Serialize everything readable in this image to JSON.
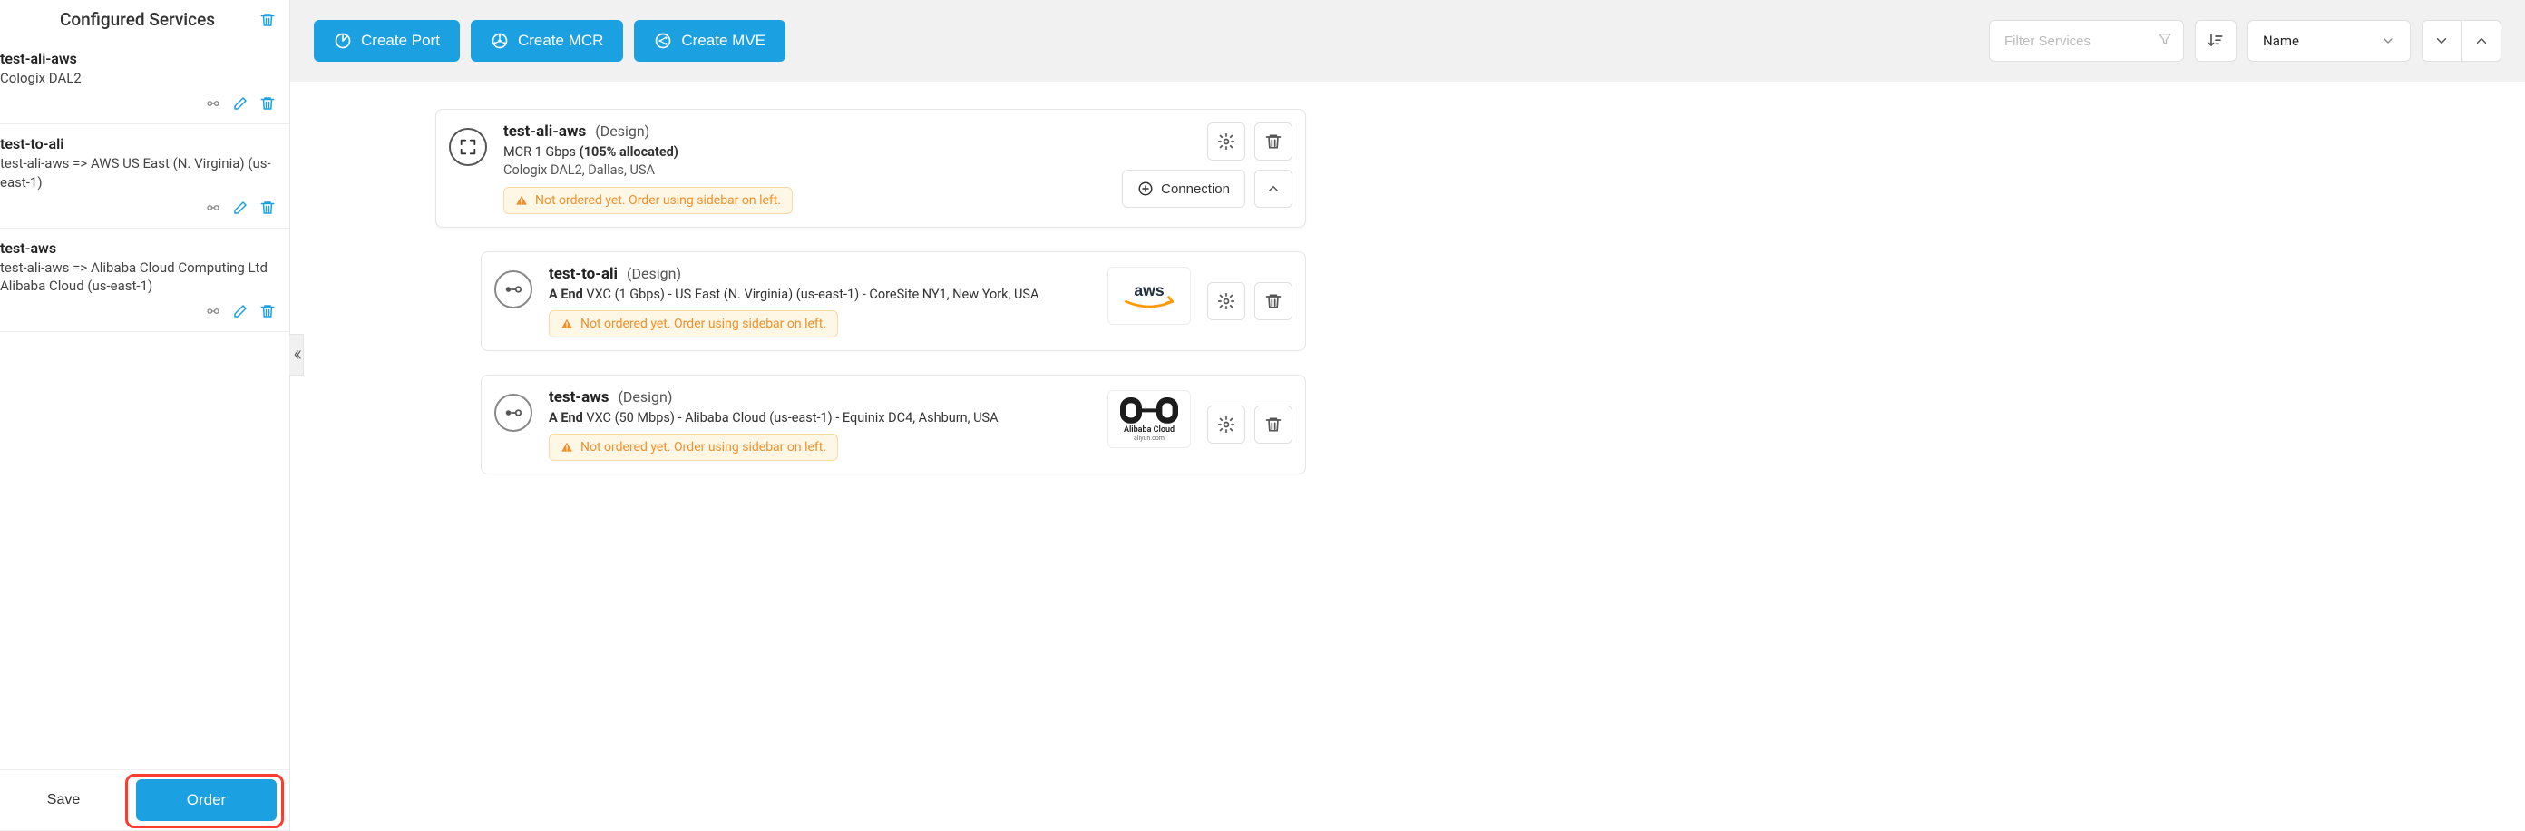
{
  "sidebar": {
    "title": "Configured Services",
    "items": [
      {
        "name": "test-ali-aws",
        "sub": "Cologix DAL2"
      },
      {
        "name": "test-to-ali",
        "sub": "test-ali-aws => AWS US East (N. Virginia) (us-east-1)"
      },
      {
        "name": "test-aws",
        "sub": "test-ali-aws => Alibaba Cloud Computing Ltd Alibaba Cloud (us-east-1)"
      }
    ],
    "save_label": "Save",
    "order_label": "Order"
  },
  "toolbar": {
    "create_port": "Create Port",
    "create_mcr": "Create MCR",
    "create_mve": "Create MVE",
    "filter_placeholder": "Filter Services",
    "sort_by": "Name"
  },
  "cards": {
    "parent": {
      "title": "test-ali-aws",
      "status": "(Design)",
      "sub_prefix": "MCR 1 Gbps ",
      "sub_bold": "(105% allocated)",
      "loc": "Cologix DAL2, Dallas, USA",
      "warning": "Not ordered yet. Order using sidebar on left.",
      "conn_label": "Connection"
    },
    "children": [
      {
        "title": "test-to-ali",
        "status": "(Design)",
        "sub_bold": "A End",
        "sub_rest": " VXC (1 Gbps) - US East (N. Virginia) (us-east-1) - CoreSite NY1, New York, USA",
        "warning": "Not ordered yet. Order using sidebar on left.",
        "cloud": "aws"
      },
      {
        "title": "test-aws",
        "status": "(Design)",
        "sub_bold": "A End",
        "sub_rest": " VXC (50 Mbps) - Alibaba Cloud (us-east-1) - Equinix DC4, Ashburn, USA",
        "warning": "Not ordered yet. Order using sidebar on left.",
        "cloud": "alibaba",
        "cloud_label": "Alibaba Cloud",
        "cloud_sublabel": "aliyun.com"
      }
    ]
  },
  "icons": {
    "trash": "trash-icon",
    "edit": "edit-icon",
    "link": "link-icon",
    "gear": "gear-icon",
    "chevron_up": "chevron-up-icon",
    "chevron_down": "chevron-down-icon",
    "plus_circle": "plus-circle-icon",
    "filter": "filter-icon",
    "sort": "sort-icon",
    "warning": "warning-icon"
  },
  "colors": {
    "primary": "#1ba1e2",
    "warning": "#f0902a",
    "danger": "#ff3b30"
  }
}
